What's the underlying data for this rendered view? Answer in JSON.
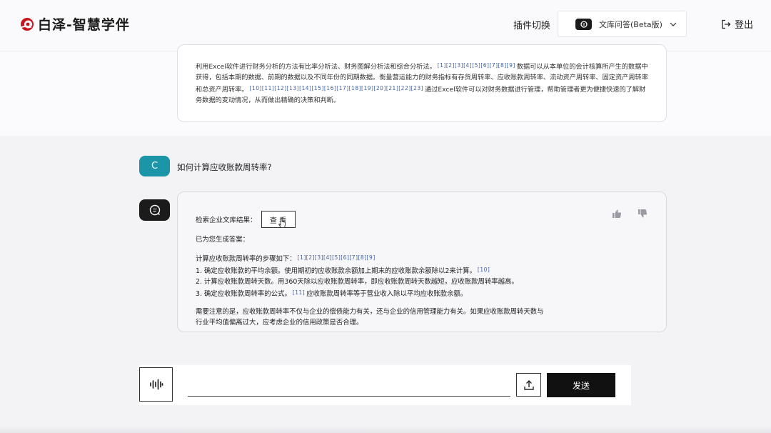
{
  "header": {
    "app_name": "白泽-智慧学伴",
    "plugin_label": "插件切换",
    "plugin_selected": "文库问答(Beta版)",
    "logout_label": "登出"
  },
  "previous_answer": {
    "segments": [
      {
        "t": "利用Excel软件进行财务分析的方法有比率分析法、财务图解分析法和综合分析法。"
      },
      {
        "c": "[1][2][3][4][5][6][7][8][9]"
      },
      {
        "t": "数据可以从本单位的会计核算所产生的数据中获得，包括本期的数据、前期的数据以及不同年份的同期数据。衡量营运能力的财务指标有存货周转率、应收账款周转率、流动资产周转率、固定资产周转率和总资产周转率。"
      },
      {
        "c": "[10][11][12][13][14][15][16][17][18][19][20][21][22][23]"
      },
      {
        "t": "通过Excel软件可以对财务数据进行管理，帮助管理者更为便捷快速的了解财务数据的变动情况，从而做出精确的决策和判断。"
      }
    ]
  },
  "user_message": {
    "avatar_letter": "C",
    "text": "如何计算应收账款周转率?"
  },
  "answer": {
    "search_label": "检索企业文库结果：",
    "view_button": "查 看",
    "generated_label": "已为您生成答案：",
    "steps_intro": "计算应收账款周转率的步骤如下：",
    "steps_intro_cite": "[1][2][3][4][5][6][7][8][9]",
    "step1": "1. 确定应收账款的平均余额。使用期初的应收账款余额加上期末的应收账款余额除以2来计算。",
    "step1_cite": "[10]",
    "step2": "2. 计算应收账款周转天数。用360天除以应收账款周转率，即应收账款周转天数越短，应收账款周转率越高。",
    "step3": "3. 确定应收账款周转率的公式。",
    "step3_cite": "[11]",
    "step3_rest": "应收账款周转率等于营业收入除以平均应收账款余额。",
    "note_line1": "需要注意的是，应收账款周转率不仅与企业的偿债能力有关，还与企业的信用管理能力有关。如果应收账款周转天数与",
    "note_line2": "行业平均值偏离过大，应考虑企业的信用政策是否合理。"
  },
  "input": {
    "value": "",
    "send_label": "发送"
  },
  "icons": {
    "logo": "baize-logo-icon",
    "plugin": "document-search-icon",
    "logout": "logout-icon",
    "voice": "voice-wave-icon",
    "upload": "upload-icon",
    "like": "thumbs-up-icon",
    "dislike": "thumbs-down-icon"
  },
  "colors": {
    "brand": "#c8161d",
    "user_avatar": "#1c95a8",
    "citation": "#3e5fa3"
  }
}
